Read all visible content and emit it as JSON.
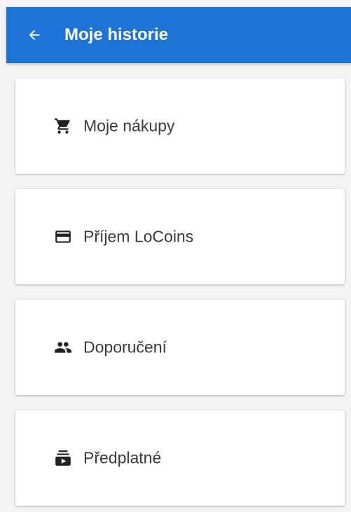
{
  "header": {
    "title": "Moje historie",
    "back_icon": "arrow-left-icon",
    "color": "#1e74d6"
  },
  "menu": {
    "items": [
      {
        "label": "Moje nákupy",
        "icon": "shopping-cart-icon"
      },
      {
        "label": "Příjem LoCoins",
        "icon": "credit-card-icon"
      },
      {
        "label": "Doporučení",
        "icon": "people-icon"
      },
      {
        "label": "Předplatné",
        "icon": "subscriptions-icon"
      }
    ]
  }
}
